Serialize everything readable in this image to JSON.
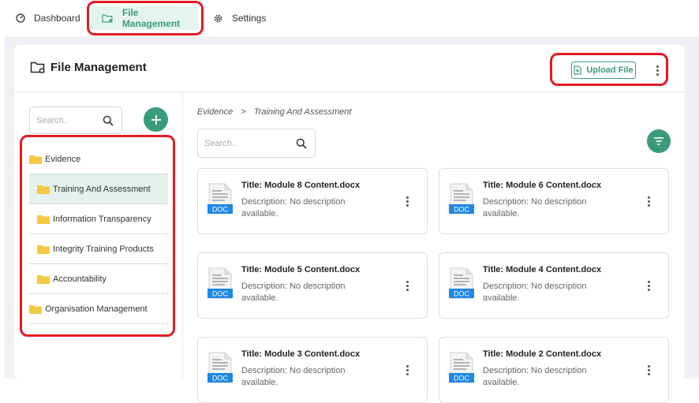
{
  "nav": {
    "items": [
      {
        "label": "Dashboard",
        "icon": "gauge-icon"
      },
      {
        "label": "File Management",
        "icon": "folder-settings-icon",
        "active": true
      },
      {
        "label": "Settings",
        "icon": "gear-icon"
      }
    ]
  },
  "header": {
    "title": "File Management",
    "upload_label": "Upload File"
  },
  "sidebar": {
    "search_placeholder": "Search..",
    "tree": [
      {
        "label": "Evidence",
        "level": 0
      },
      {
        "label": "Training And Assessment",
        "level": 1,
        "selected": true
      },
      {
        "label": "Information Transparency",
        "level": 1
      },
      {
        "label": "Integrity Training Products",
        "level": 1
      },
      {
        "label": "Accountability",
        "level": 1
      },
      {
        "label": "Organisation Management",
        "level": 0
      }
    ]
  },
  "main": {
    "breadcrumb": [
      "Evidence",
      "Training And Assessment"
    ],
    "breadcrumb_separator": ">",
    "search_placeholder": "Search..",
    "files": [
      {
        "title": "Title: Module 8 Content.docx",
        "description": "Description: No description available.",
        "badge": "DOC"
      },
      {
        "title": "Title: Module 6 Content.docx",
        "description": "Description: No description available.",
        "badge": "DOC"
      },
      {
        "title": "Title: Module 5 Content.docx",
        "description": "Description: No description available.",
        "badge": "DOC"
      },
      {
        "title": "Title: Module 4 Content.docx",
        "description": "Description: No description available.",
        "badge": "DOC"
      },
      {
        "title": "Title: Module 3 Content.docx",
        "description": "Description: No description available.",
        "badge": "DOC"
      },
      {
        "title": "Title: Module 2 Content.docx",
        "description": "Description: No description available.",
        "badge": "DOC"
      }
    ]
  },
  "colors": {
    "accent": "#3a9b7c",
    "highlight": "#e31b23",
    "folder": "#f6c944",
    "doc_badge": "#1e88e5"
  }
}
